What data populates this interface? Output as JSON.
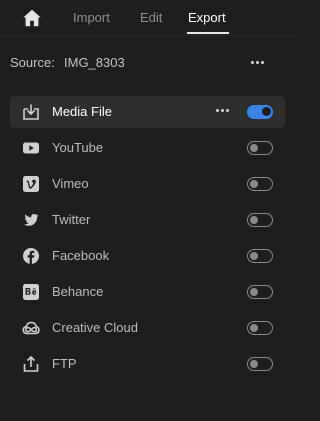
{
  "nav": {
    "home_icon": "home-icon",
    "tabs": [
      {
        "label": "Import",
        "active": false
      },
      {
        "label": "Edit",
        "active": false
      },
      {
        "label": "Export",
        "active": true
      }
    ]
  },
  "source": {
    "label": "Source:",
    "value": "IMG_8303",
    "more_icon": "more-horizontal-icon"
  },
  "destinations": [
    {
      "label": "Media File",
      "icon": "download-icon",
      "enabled": true,
      "selected": true
    },
    {
      "label": "YouTube",
      "icon": "youtube-icon",
      "enabled": false
    },
    {
      "label": "Vimeo",
      "icon": "vimeo-icon",
      "enabled": false
    },
    {
      "label": "Twitter",
      "icon": "twitter-icon",
      "enabled": false
    },
    {
      "label": "Facebook",
      "icon": "facebook-icon",
      "enabled": false
    },
    {
      "label": "Behance",
      "icon": "behance-icon",
      "enabled": false
    },
    {
      "label": "Creative Cloud",
      "icon": "creative-cloud-icon",
      "enabled": false
    },
    {
      "label": "FTP",
      "icon": "upload-icon",
      "enabled": false
    }
  ],
  "colors": {
    "background": "#1e1e1e",
    "selected_row": "#2e2e2e",
    "accent": "#3a86e8",
    "active_tab": "#ffffff",
    "inactive_tab": "#8f8f8f"
  }
}
